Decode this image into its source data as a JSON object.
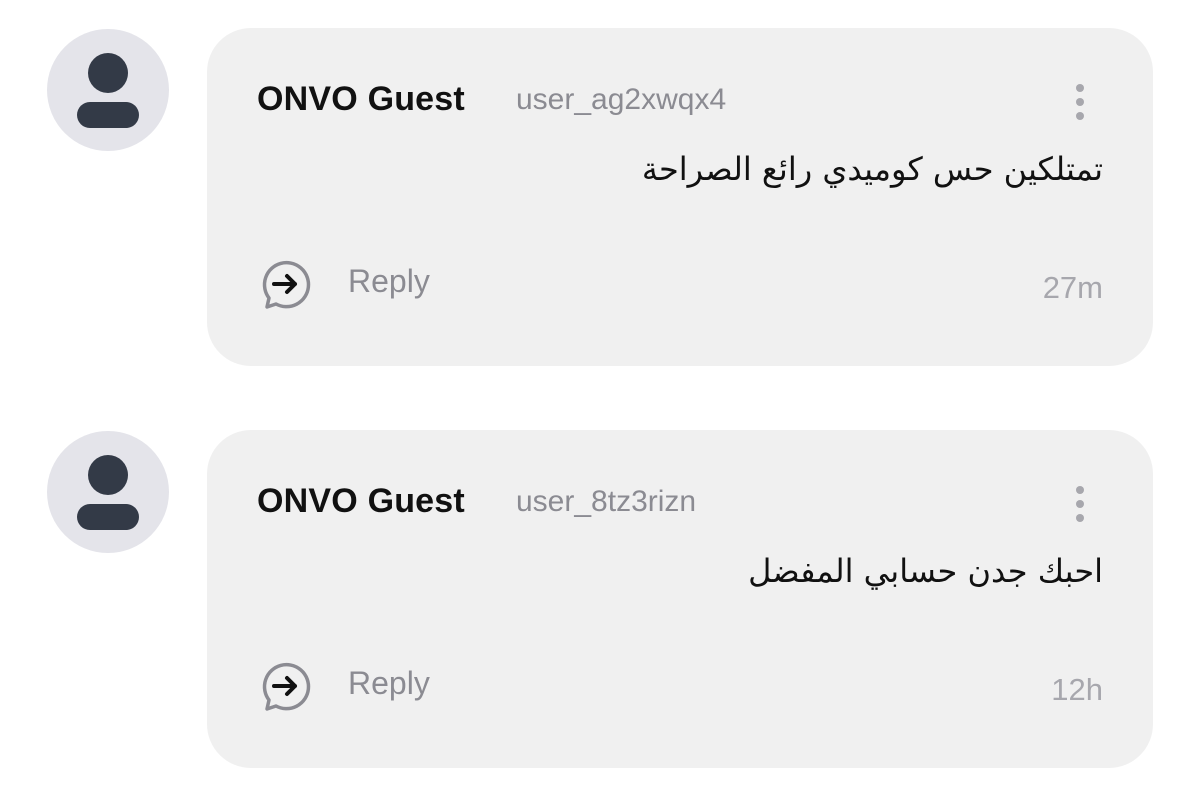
{
  "comments": [
    {
      "author": "ONVO Guest",
      "handle": "user_ag2xwqx4",
      "message": "تمتلكين حس كوميدي رائع الصراحة",
      "reply_label": "Reply",
      "time": "27m",
      "icons": {
        "avatar": "user-avatar-icon",
        "menu": "more-vertical-icon",
        "reply": "reply-arrow-icon"
      }
    },
    {
      "author": "ONVO Guest",
      "handle": "user_8tz3rizn",
      "message": "احبك جدن حسابي المفضل",
      "reply_label": "Reply",
      "time": "12h",
      "icons": {
        "avatar": "user-avatar-icon",
        "menu": "more-vertical-icon",
        "reply": "reply-arrow-icon"
      }
    }
  ],
  "colors": {
    "bubble_bg": "#f0f0f0",
    "avatar_bg": "#e4e4ea",
    "avatar_fg": "#333a47",
    "secondary_text": "#8b8b92",
    "muted_text": "#a7a7ad"
  }
}
